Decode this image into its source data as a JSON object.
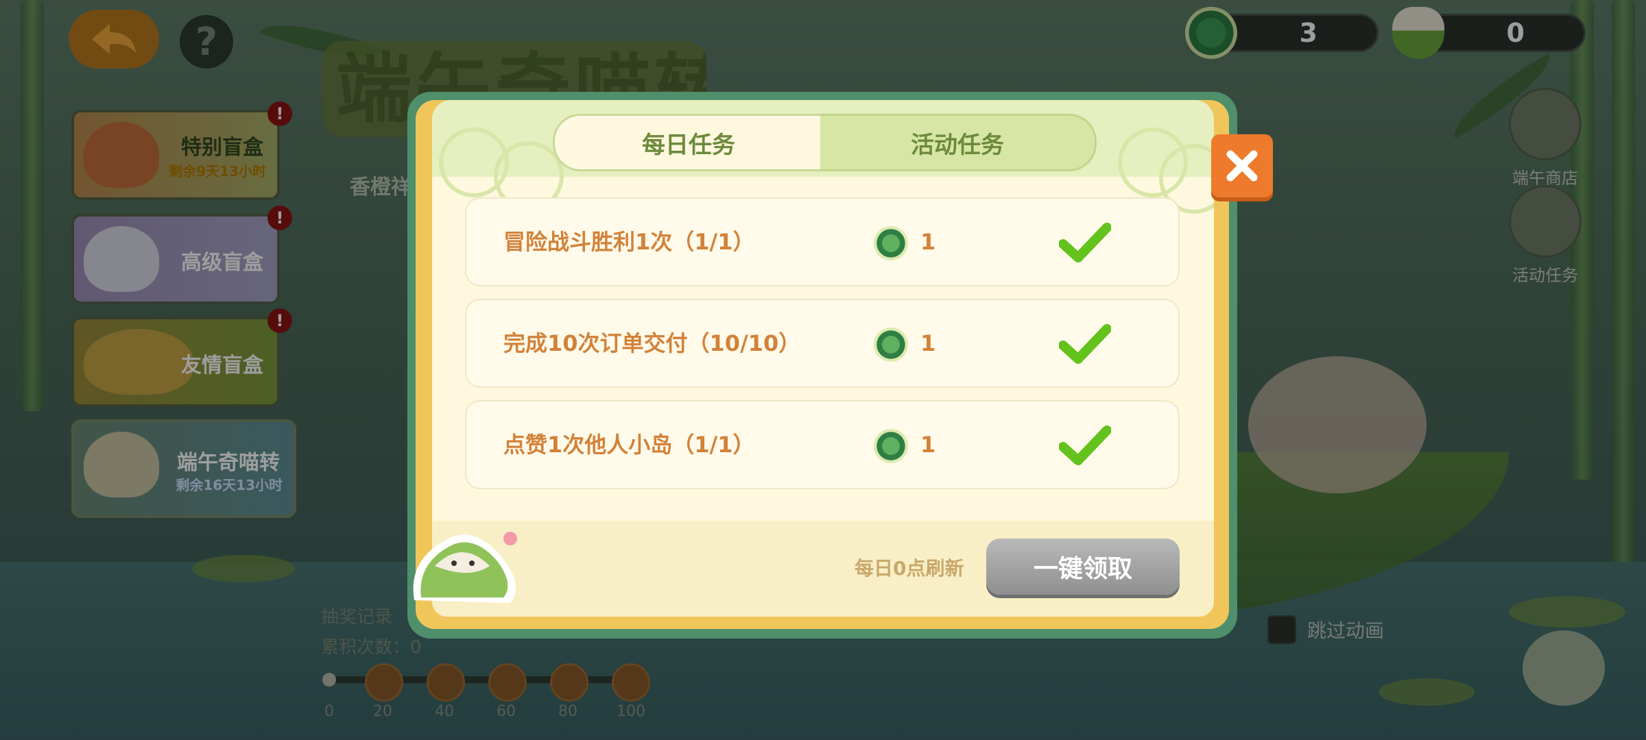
{
  "header": {
    "title_text": "端午奇喵转",
    "currencies": [
      {
        "icon": "green-coin-icon",
        "value": "3"
      },
      {
        "icon": "zongzi-icon",
        "value": "0"
      }
    ]
  },
  "left_cards": [
    {
      "label": "特别盲盒",
      "sub": "剩余9天13小时",
      "badge": "!"
    },
    {
      "label": "高级盲盒",
      "sub": "",
      "badge": "!"
    },
    {
      "label": "友情盲盒",
      "sub": "",
      "badge": "!"
    },
    {
      "label": "端午奇喵转",
      "sub": "剩余16天13小时",
      "badge": ""
    }
  ],
  "left_partial_text": "香橙祥",
  "right_nav": [
    {
      "label": "端午商店",
      "icon": "shop-icon"
    },
    {
      "label": "活动任务",
      "icon": "task-icon"
    }
  ],
  "progress": {
    "record_label": "抽奖记录",
    "count_label": "累积次数：",
    "count_value": "0",
    "ticks": [
      "0",
      "20",
      "40",
      "60",
      "80",
      "100"
    ]
  },
  "skip_label": "跳过动画",
  "modal": {
    "tabs": [
      "每日任务",
      "活动任务"
    ],
    "active_tab": 0,
    "tasks": [
      {
        "name": "冒险战斗胜利1次（1/1）",
        "reward": "1",
        "done": true
      },
      {
        "name": "完成10次订单交付（10/10）",
        "reward": "1",
        "done": true
      },
      {
        "name": "点赞1次他人小岛（1/1）",
        "reward": "1",
        "done": true
      }
    ],
    "refresh_note": "每日0点刷新",
    "claim_button": "一键领取"
  },
  "colors": {
    "accent_orange": "#ee7b2b",
    "task_text": "#d28239",
    "tab_text": "#6d8a3c",
    "check_green": "#63c21c",
    "claim_disabled": "#a3a3a3"
  }
}
